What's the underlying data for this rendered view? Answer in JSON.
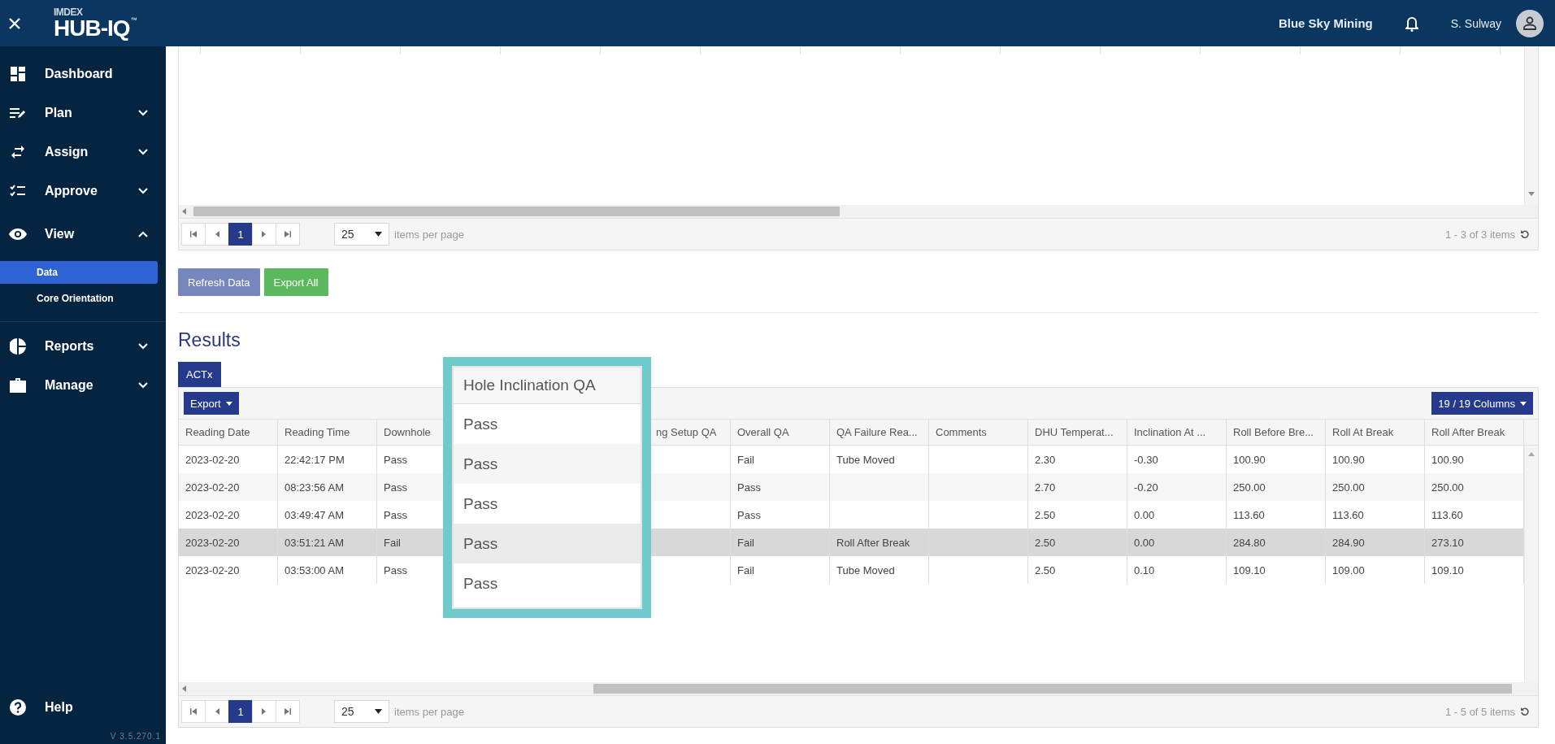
{
  "app_bar": {
    "logo_brand": "IMDEX",
    "logo_product": "HUB-IQ",
    "logo_mark": "™",
    "organization": "Blue Sky Mining",
    "user": "S. Sulway"
  },
  "sidebar": {
    "items": [
      {
        "label": "Dashboard",
        "kind": "link"
      },
      {
        "label": "Plan",
        "kind": "group",
        "expanded": false
      },
      {
        "label": "Assign",
        "kind": "group",
        "expanded": false
      },
      {
        "label": "Approve",
        "kind": "group",
        "expanded": false
      },
      {
        "label": "View",
        "kind": "group",
        "expanded": true,
        "children": [
          {
            "label": "Data",
            "selected": true
          },
          {
            "label": "Core Orientation",
            "selected": false
          }
        ]
      },
      {
        "label": "Reports",
        "kind": "group",
        "expanded": false
      },
      {
        "label": "Manage",
        "kind": "group",
        "expanded": false
      }
    ],
    "help": "Help",
    "version": "V 3.5.270.1"
  },
  "top_grid": {
    "pager": {
      "page": "1",
      "page_size": "25",
      "page_size_label": "items per page",
      "summary": "1 - 3 of 3 items"
    }
  },
  "buttons": [
    {
      "label": "Refresh Data",
      "kind": "secondary"
    },
    {
      "label": "Export All",
      "kind": "success"
    }
  ],
  "results": {
    "title": "Results",
    "tabs": [
      {
        "label": "ACTx",
        "selected": true
      }
    ],
    "export_label": "Export",
    "columns_label": "19 / 19 Columns",
    "columns": [
      "Reading Date",
      "Reading Time",
      "Downhole",
      null,
      "ng Setup QA",
      "Overall QA",
      "QA Failure Rea...",
      "Comments",
      "DHU Temperat...",
      "Inclination At ...",
      "Roll Before Bre...",
      "Roll At Break",
      "Roll After Break"
    ],
    "rows": [
      {
        "hovered": false,
        "cells": [
          "2023-02-20",
          "22:42:17 PM",
          "Pass",
          null,
          null,
          "Fail",
          "Tube Moved",
          null,
          "2.30",
          "-0.30",
          "100.90",
          "100.90",
          "100.90"
        ]
      },
      {
        "hovered": false,
        "cells": [
          "2023-02-20",
          "08:23:56 AM",
          "Pass",
          null,
          null,
          "Pass",
          null,
          null,
          "2.70",
          "-0.20",
          "250.00",
          "250.00",
          "250.00"
        ]
      },
      {
        "hovered": false,
        "cells": [
          "2023-02-20",
          "03:49:47 AM",
          "Pass",
          null,
          null,
          "Pass",
          null,
          null,
          "2.50",
          "0.00",
          "113.60",
          "113.60",
          "113.60"
        ]
      },
      {
        "hovered": true,
        "cells": [
          "2023-02-20",
          "03:51:21 AM",
          "Fail",
          null,
          null,
          "Fail",
          "Roll After Break",
          null,
          "2.50",
          "0.00",
          "284.80",
          "284.90",
          "273.10"
        ]
      },
      {
        "hovered": false,
        "cells": [
          "2023-02-20",
          "03:53:00 AM",
          "Pass",
          null,
          null,
          "Fail",
          "Tube Moved",
          null,
          "2.50",
          "0.10",
          "109.10",
          "109.00",
          "109.10"
        ]
      }
    ],
    "pager": {
      "page": "1",
      "page_size": "25",
      "page_size_label": "items per page",
      "summary": "1 - 5 of 5 items"
    }
  },
  "callout": {
    "title": "Hole Inclination QA",
    "cells": [
      "Pass",
      "Pass",
      "Pass",
      "Pass",
      "Pass"
    ]
  }
}
